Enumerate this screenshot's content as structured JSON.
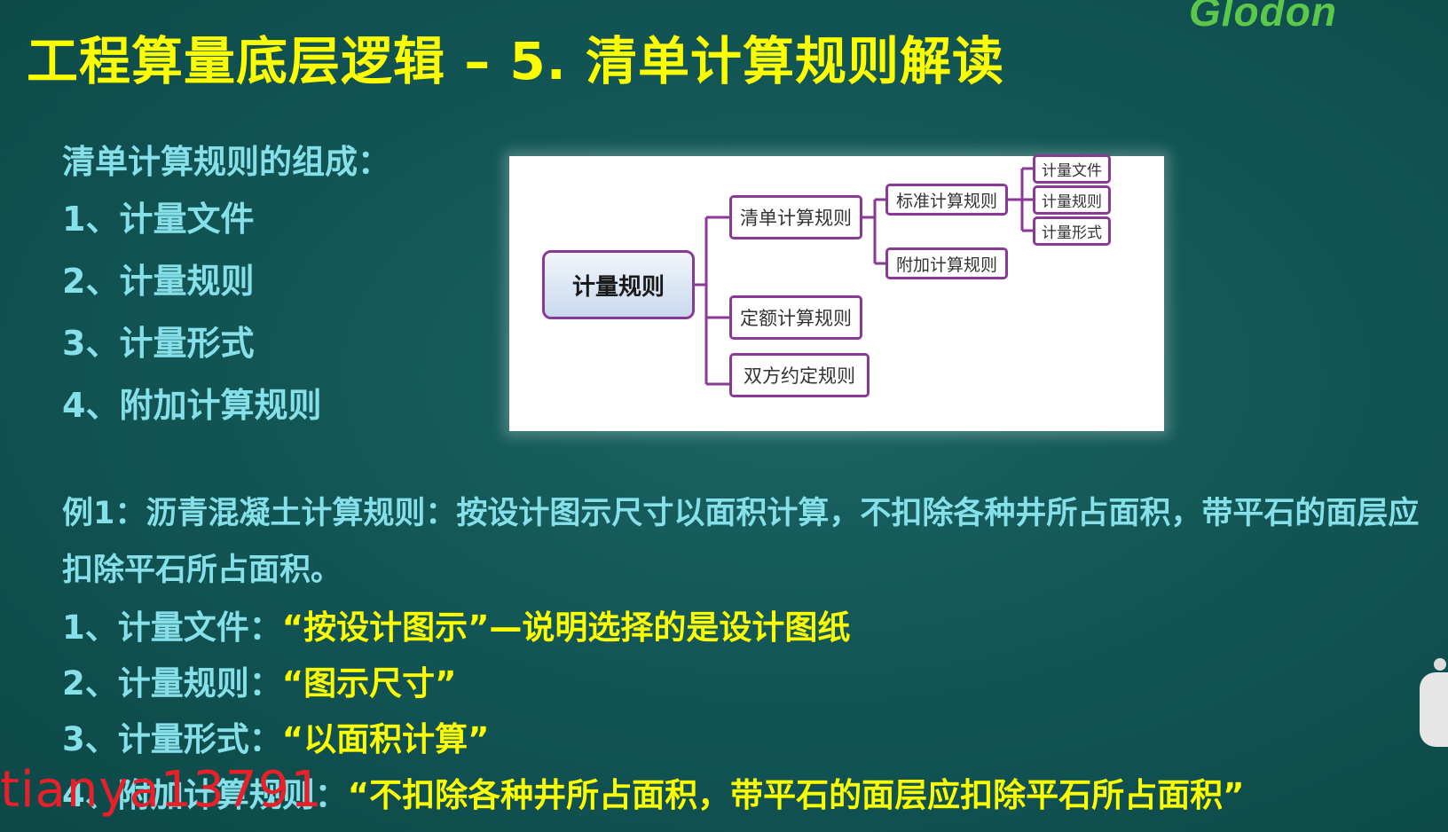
{
  "logo": "Glodon",
  "title": "工程算量底层逻辑 –    5. 清单计算规则解读",
  "composition": {
    "heading": "清单计算规则的组成：",
    "items": [
      "1、计量文件",
      "2、计量规则",
      "3、计量形式",
      "4、附加计算规则"
    ]
  },
  "diagram": {
    "root": "计量规则",
    "qd": "清单计算规则",
    "de": "定额计算规则",
    "sf": "双方约定规则",
    "bz": "标准计算规则",
    "fj": "附加计算规则",
    "wj": "计量文件",
    "gz": "计量规则",
    "xs": "计量形式"
  },
  "example": {
    "line1": "例1：沥青混凝土计算规则：按设计图示尺寸以面积计算，不扣除各种井所占面积，带平石的面层应",
    "line2": "扣除平石所占面积。",
    "mappings": [
      {
        "label": "1、计量文件：",
        "quote": "“按设计图示”—说明选择的是设计图纸"
      },
      {
        "label": "2、计量规则：",
        "quote": "“图示尺寸”"
      },
      {
        "label": "3、计量形式：",
        "quote": "“以面积计算”"
      },
      {
        "label": "4、附加计算规则：",
        "quote": "“不扣除各种井所占面积，带平石的面层应扣除平石所占面积”"
      }
    ]
  },
  "watermark": "tianya13791",
  "colors": {
    "title": "#fbfd00",
    "text": "#86e0ea",
    "node_border": "#8a3a96",
    "watermark": "#e8202a"
  }
}
